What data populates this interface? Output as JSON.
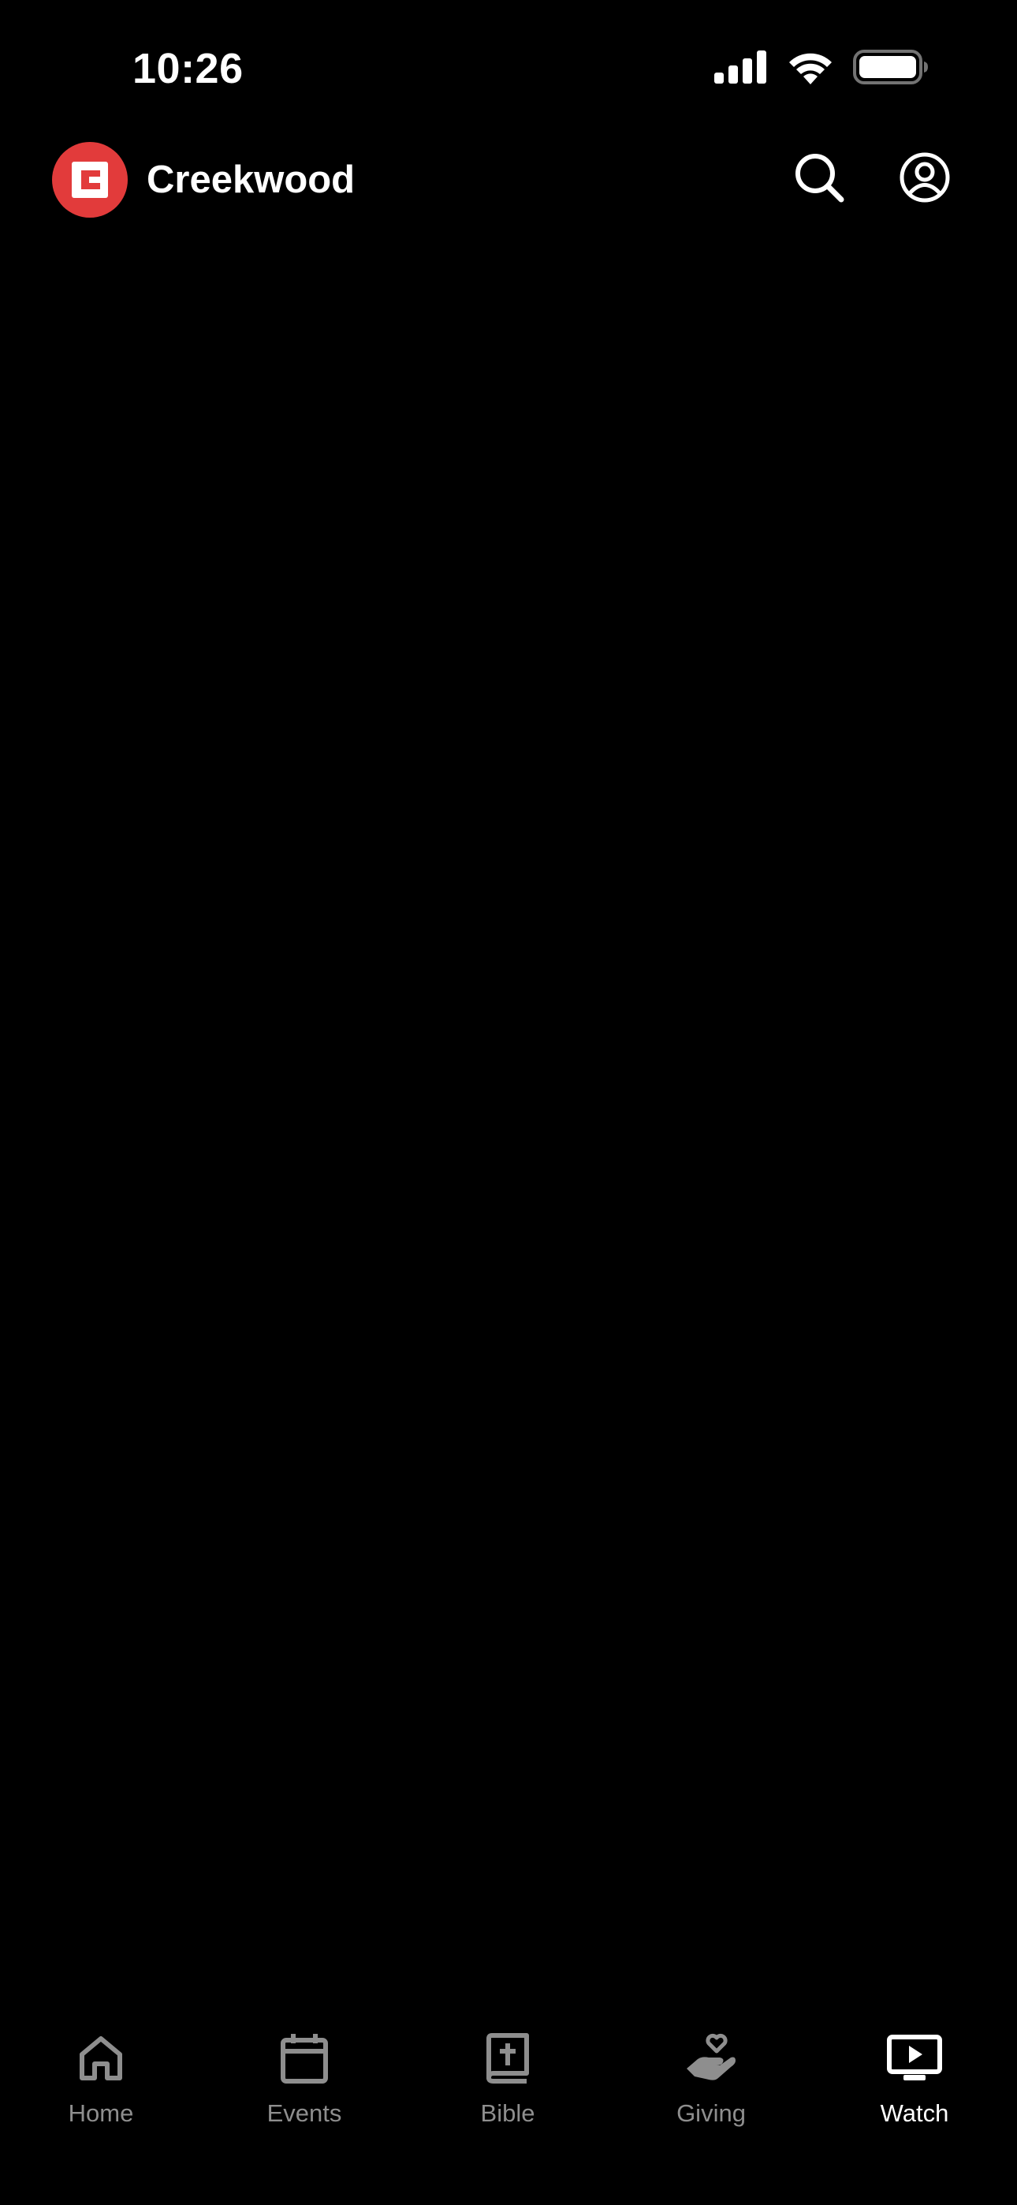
{
  "status_bar": {
    "time": "10:26"
  },
  "header": {
    "app_name": "Creekwood",
    "logo_letter": "C",
    "brand_color": "#e23b3b",
    "actions": [
      {
        "name": "search",
        "icon": "search-icon"
      },
      {
        "name": "profile",
        "icon": "user-circle-icon"
      }
    ]
  },
  "tab_bar": {
    "active_tab": "Watch",
    "active_color": "#ffffff",
    "inactive_color": "#8e8e8e",
    "tabs": [
      {
        "label": "Home",
        "icon": "home-icon"
      },
      {
        "label": "Events",
        "icon": "calendar-icon"
      },
      {
        "label": "Bible",
        "icon": "bible-icon"
      },
      {
        "label": "Giving",
        "icon": "giving-hand-icon"
      },
      {
        "label": "Watch",
        "icon": "tv-play-icon"
      }
    ]
  }
}
